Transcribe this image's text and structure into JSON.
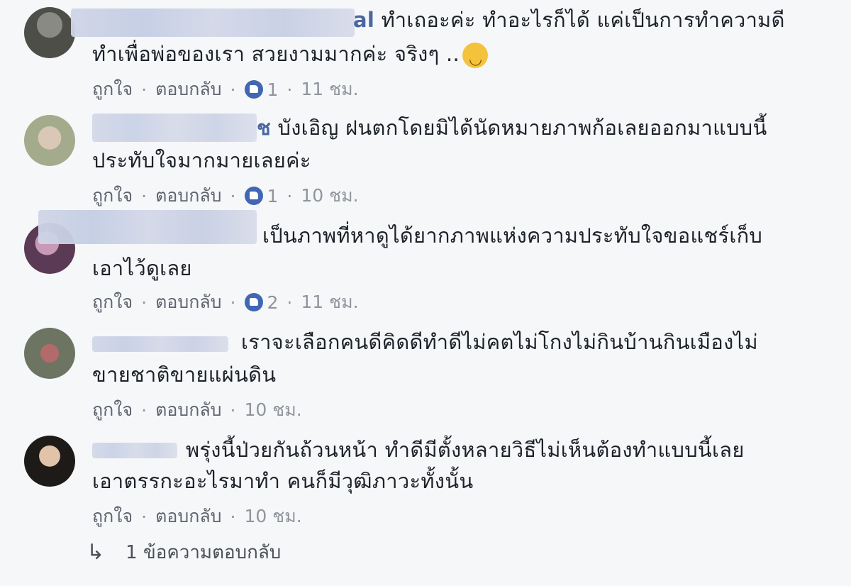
{
  "comments": [
    {
      "name_visible": "al",
      "line1": "ทำเถอะค่ะ ทำอะไรก็ได้ แค่เป็นการทำความดี",
      "line2": "ทำเพื่อพ่อของเรา สวยงามมากค่ะ จริงๆ ..",
      "emoji": "smile-emoji",
      "like_label": "ถูกใจ",
      "reply_label": "ตอบกลับ",
      "reactions": "1",
      "time": "11 ชม."
    },
    {
      "name_visible": "ช",
      "line1": "บังเอิญ ฝนตกโดยมิได้นัดหมายภาพก้อเลยออกมาแบบนี้",
      "line2": "ประทับใจมากมายเลยค่ะ",
      "like_label": "ถูกใจ",
      "reply_label": "ตอบกลับ",
      "reactions": "1",
      "time": "10 ชม."
    },
    {
      "name_visible": "",
      "line1": "เป็นภาพที่หาดูได้ยากภาพแห่งความประทับใจขอแชร์เก็บ",
      "line2": "เอาไว้ดูเลย",
      "like_label": "ถูกใจ",
      "reply_label": "ตอบกลับ",
      "reactions": "2",
      "time": "11 ชม."
    },
    {
      "name_visible": "",
      "line1": "เราจะเลือกคนดีคิดดีทำดีไม่คตไม่โกงไม่กินบ้านกินเมืองไม่",
      "line2": "ขายชาติขายแผ่นดิน",
      "like_label": "ถูกใจ",
      "reply_label": "ตอบกลับ",
      "time": "10 ชม."
    },
    {
      "name_visible": "",
      "line1": "พรุ่งนี้ป่วยกันถ้วนหน้า ทำดีมีตั้งหลายวิธีไม่เห็นต้องทำแบบนี้เลย",
      "line2": "เอาตรรกะอะไรมาทำ คนก็มีวุฒิภาวะทั้งนั้น",
      "like_label": "ถูกใจ",
      "reply_label": "ตอบกลับ",
      "time": "10 ชม."
    }
  ],
  "replies_link": "1 ข้อความตอบกลับ",
  "colors": {
    "accent": "#4267b2",
    "name": "#4b67a1",
    "meta": "#90949c",
    "background": "#f6f7f9"
  }
}
